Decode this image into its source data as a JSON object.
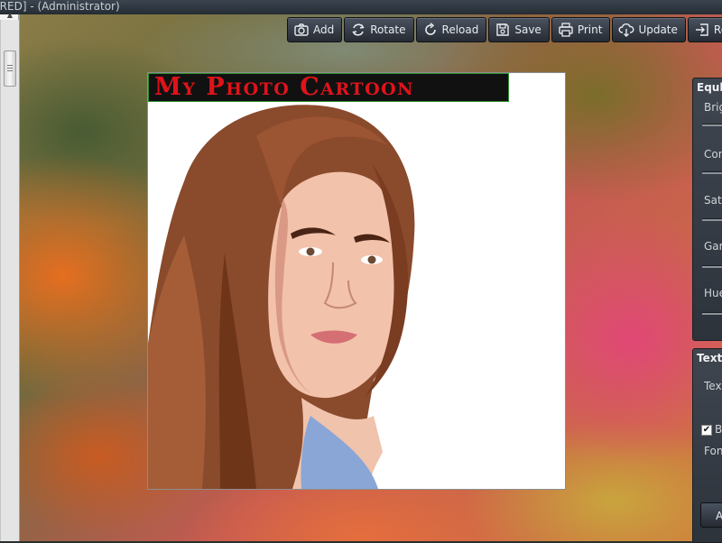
{
  "window": {
    "title": "[RED] - (Administrator)"
  },
  "toolbar": {
    "buttons": [
      {
        "label": "Add",
        "icon": "camera-icon"
      },
      {
        "label": "Rotate",
        "icon": "rotate-icon"
      },
      {
        "label": "Reload",
        "icon": "reload-icon"
      },
      {
        "label": "Save",
        "icon": "save-icon"
      },
      {
        "label": "Print",
        "icon": "printer-icon"
      },
      {
        "label": "Update",
        "icon": "cloud-download-icon"
      },
      {
        "label": "Regis",
        "icon": "register-icon"
      }
    ]
  },
  "canvas": {
    "caption": "My Photo Cartoon",
    "caption_color": "#e0131a",
    "image_description_icon": "cartoon-portrait-icon"
  },
  "equalizer_panel": {
    "header": "Equli",
    "sliders": [
      {
        "label": "Brig"
      },
      {
        "label": "Con"
      },
      {
        "label": "Satu"
      },
      {
        "label": "Gam"
      },
      {
        "label": "Hue"
      }
    ]
  },
  "text_panel": {
    "header": "Text",
    "text_label": "Text",
    "checkbox_label": "Ba",
    "checkbox_checked": true,
    "font_label": "Font",
    "apply_label": "A"
  },
  "colors": {
    "toolbar_bg": "#2f353e",
    "toolbar_text": "#e8ecef",
    "canvas_bg": "#ffffff"
  }
}
